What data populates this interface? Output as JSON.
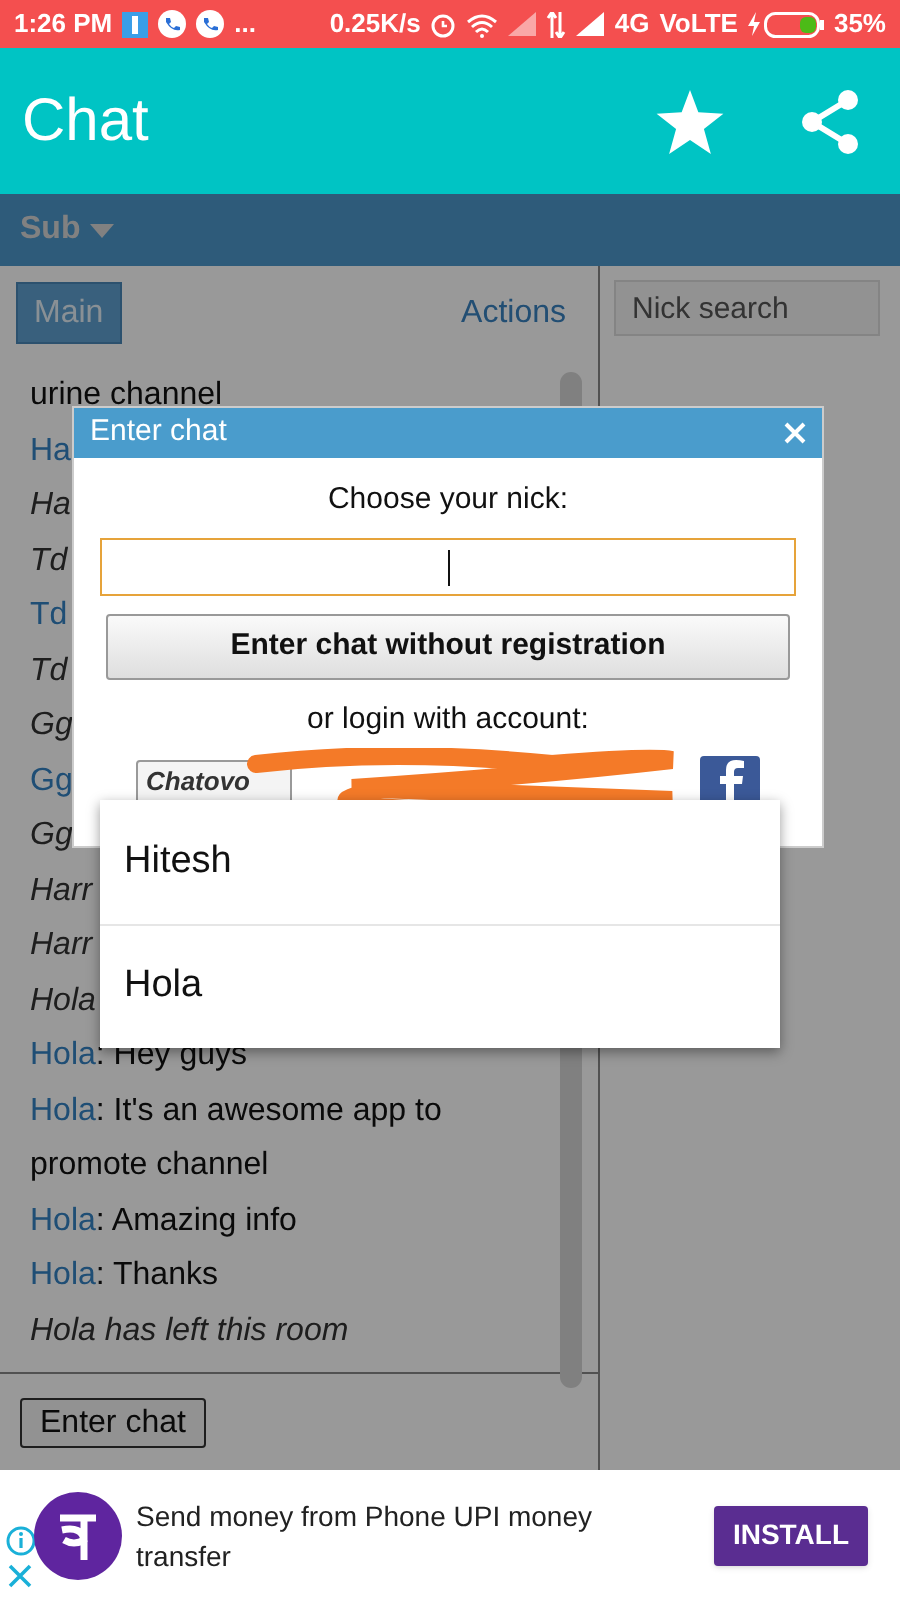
{
  "status_bar": {
    "time": "1:26 PM",
    "more": "...",
    "speed": "0.25K/s",
    "network": "4G",
    "volte": "VoLTE",
    "battery": "35%"
  },
  "app_bar": {
    "title": "Chat"
  },
  "sub_bar": {
    "label": "Sub"
  },
  "tabs": [
    {
      "label": "Main",
      "selected": true
    },
    {
      "label": "Actions",
      "selected": false
    }
  ],
  "nick_search": {
    "placeholder": "Nick search"
  },
  "messages": [
    {
      "kind": "plain",
      "text": "urine channel"
    },
    {
      "kind": "message",
      "nick": "Ha"
    },
    {
      "kind": "event",
      "text": "Ha"
    },
    {
      "kind": "event",
      "text": "Td"
    },
    {
      "kind": "message",
      "nick": "Td"
    },
    {
      "kind": "event",
      "text": "Td"
    },
    {
      "kind": "event",
      "text": "Gg"
    },
    {
      "kind": "message",
      "nick": "Gg"
    },
    {
      "kind": "event",
      "text": "Gg"
    },
    {
      "kind": "event",
      "text": "Harr"
    },
    {
      "kind": "event",
      "text": "Harr"
    },
    {
      "kind": "event",
      "text": "Hola"
    },
    {
      "kind": "message",
      "nick": "Hola",
      "text": ": Hey guys"
    },
    {
      "kind": "message",
      "nick": "Hola",
      "text": ": It's an awesome app to promote channel"
    },
    {
      "kind": "message",
      "nick": "Hola",
      "text": ": Amazing info"
    },
    {
      "kind": "message",
      "nick": "Hola",
      "text": ": Thanks"
    },
    {
      "kind": "event",
      "text": "Hola has left this room"
    }
  ],
  "enter_button": "Enter chat",
  "dialog": {
    "title": "Enter chat",
    "prompt": "Choose your nick:",
    "button": "Enter chat without registration",
    "login_label": "or login with account:",
    "chatovod": "Chatovo"
  },
  "suggestions": [
    {
      "label": "Hitesh"
    },
    {
      "label": "Hola"
    }
  ],
  "ad": {
    "text": "Send money from Phone UPI money transfer",
    "button": "INSTALL"
  }
}
